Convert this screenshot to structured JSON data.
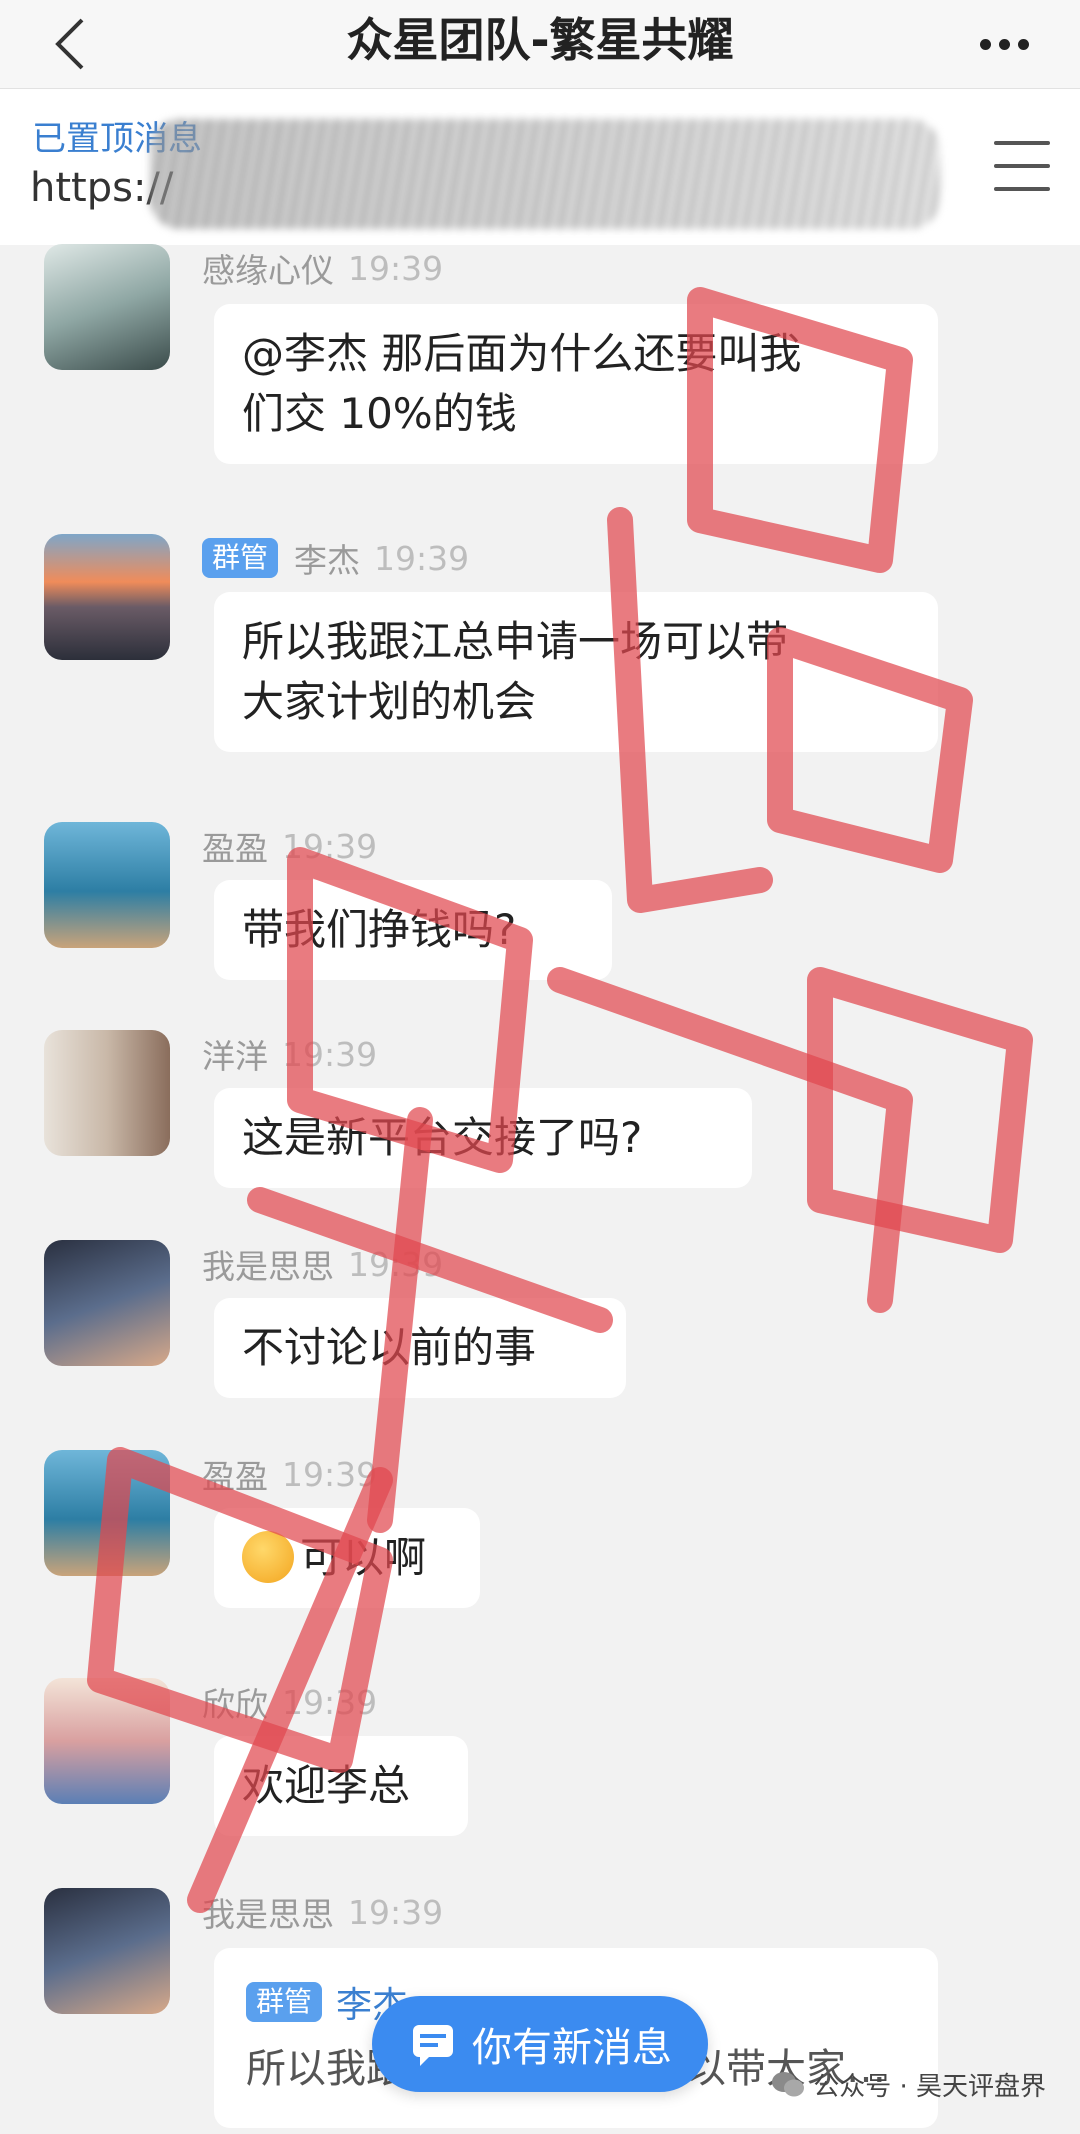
{
  "header": {
    "title": "众星团队-繁星共耀",
    "back_icon": "chevron-left-icon",
    "more_icon": "more-dots-icon"
  },
  "pinned": {
    "label": "已置顶消息",
    "link_text": "https://",
    "menu_icon": "menu-icon"
  },
  "messages": [
    {
      "sender": "感缘心仪",
      "time": "19:39",
      "text_lines": [
        "@李杰 那后面为什么还要叫我",
        "们交 10%的钱"
      ]
    },
    {
      "badge": "群管",
      "sender": "李杰",
      "time": "19:39",
      "text_lines": [
        "所以我跟江总申请一场可以带",
        "大家计划的机会"
      ]
    },
    {
      "sender": "盈盈",
      "time": "19:39",
      "text_lines": [
        "带我们挣钱吗?"
      ]
    },
    {
      "sender": "洋洋",
      "time": "19:39",
      "text_lines": [
        "这是新平台交接了吗?"
      ]
    },
    {
      "sender": "我是思思",
      "time": "19:39",
      "text_lines": [
        "不讨论以前的事"
      ]
    },
    {
      "sender": "盈盈",
      "time": "19:39",
      "text_lines": [
        "可以啊"
      ]
    },
    {
      "sender": "欣欣",
      "time": "19:39",
      "text_lines": [
        "欢迎李总"
      ]
    },
    {
      "sender": "我是思思",
      "time": "19:39"
    }
  ],
  "quote": {
    "badge": "群管",
    "sender": "李杰:",
    "text": "所以我跟江总申请一场可以带大家…"
  },
  "new_message_button": {
    "label": "你有新消息",
    "icon": "message-icon"
  },
  "watermark": {
    "text": "公众号 · 昊天评盘界",
    "icon": "wechat-icon"
  },
  "colors": {
    "accent": "#3b8bf0",
    "badge": "#5aa0ee",
    "stamp": "#e0484f"
  }
}
